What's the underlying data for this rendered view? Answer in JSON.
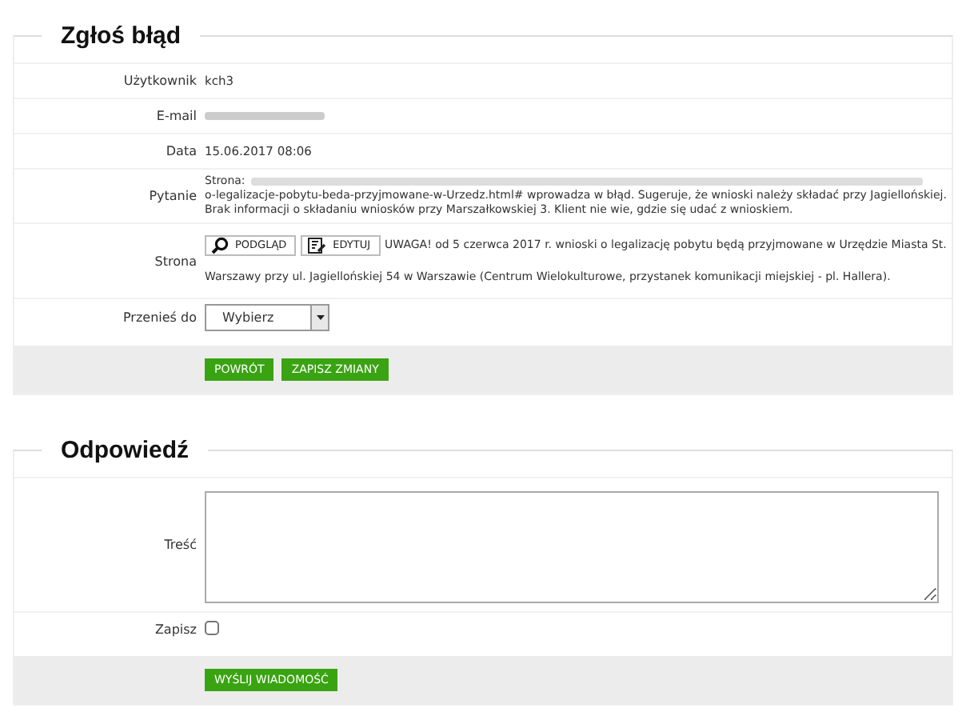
{
  "report": {
    "title": "Zgłoś błąd",
    "rows": [
      {
        "kind": "text",
        "label": "Użytkownik",
        "value": "kch3"
      },
      {
        "kind": "redacted",
        "label": "E-mail"
      },
      {
        "kind": "text",
        "label": "Data",
        "value": "15.06.2017 08:06"
      },
      {
        "kind": "question",
        "label": "Pytanie",
        "prefix": "Strona:",
        "value": "o-legalizacje-pobytu-beda-przyjmowane-w-Urzedz.html# wprowadza w błąd. Sugeruje, że wnioski należy składać przy Jagiellońskiej. Brak informacji o składaniu wniosków przy Marszałkowskiej 3. Klient nie wie, gdzie się udać z wnioskiem."
      },
      {
        "kind": "page",
        "label": "Strona",
        "buttons": [
          "PODGLĄD",
          "EDYTUJ"
        ],
        "lines": [
          "UWAGA! od 5 czerwca 2017 r. wnioski o legalizację pobytu będą przyjmowane w Urzędzie Miasta St.",
          "Warszawy przy ul. Jagiellońskiej 54 w Warszawie (Centrum Wielokulturowe, przystanek komunikacji miejskiej - pl. Hallera)."
        ]
      },
      {
        "kind": "select",
        "label": "Przenieś do",
        "value": "Wybierz"
      }
    ],
    "buttons": [
      "POWRÓT",
      "ZAPISZ ZMIANY"
    ]
  },
  "reply": {
    "title": "Odpowiedź",
    "content_label": "Treść",
    "save_label": "Zapisz",
    "save_checked": false,
    "button": "WYŚLIJ WIADOMOŚĆ"
  }
}
